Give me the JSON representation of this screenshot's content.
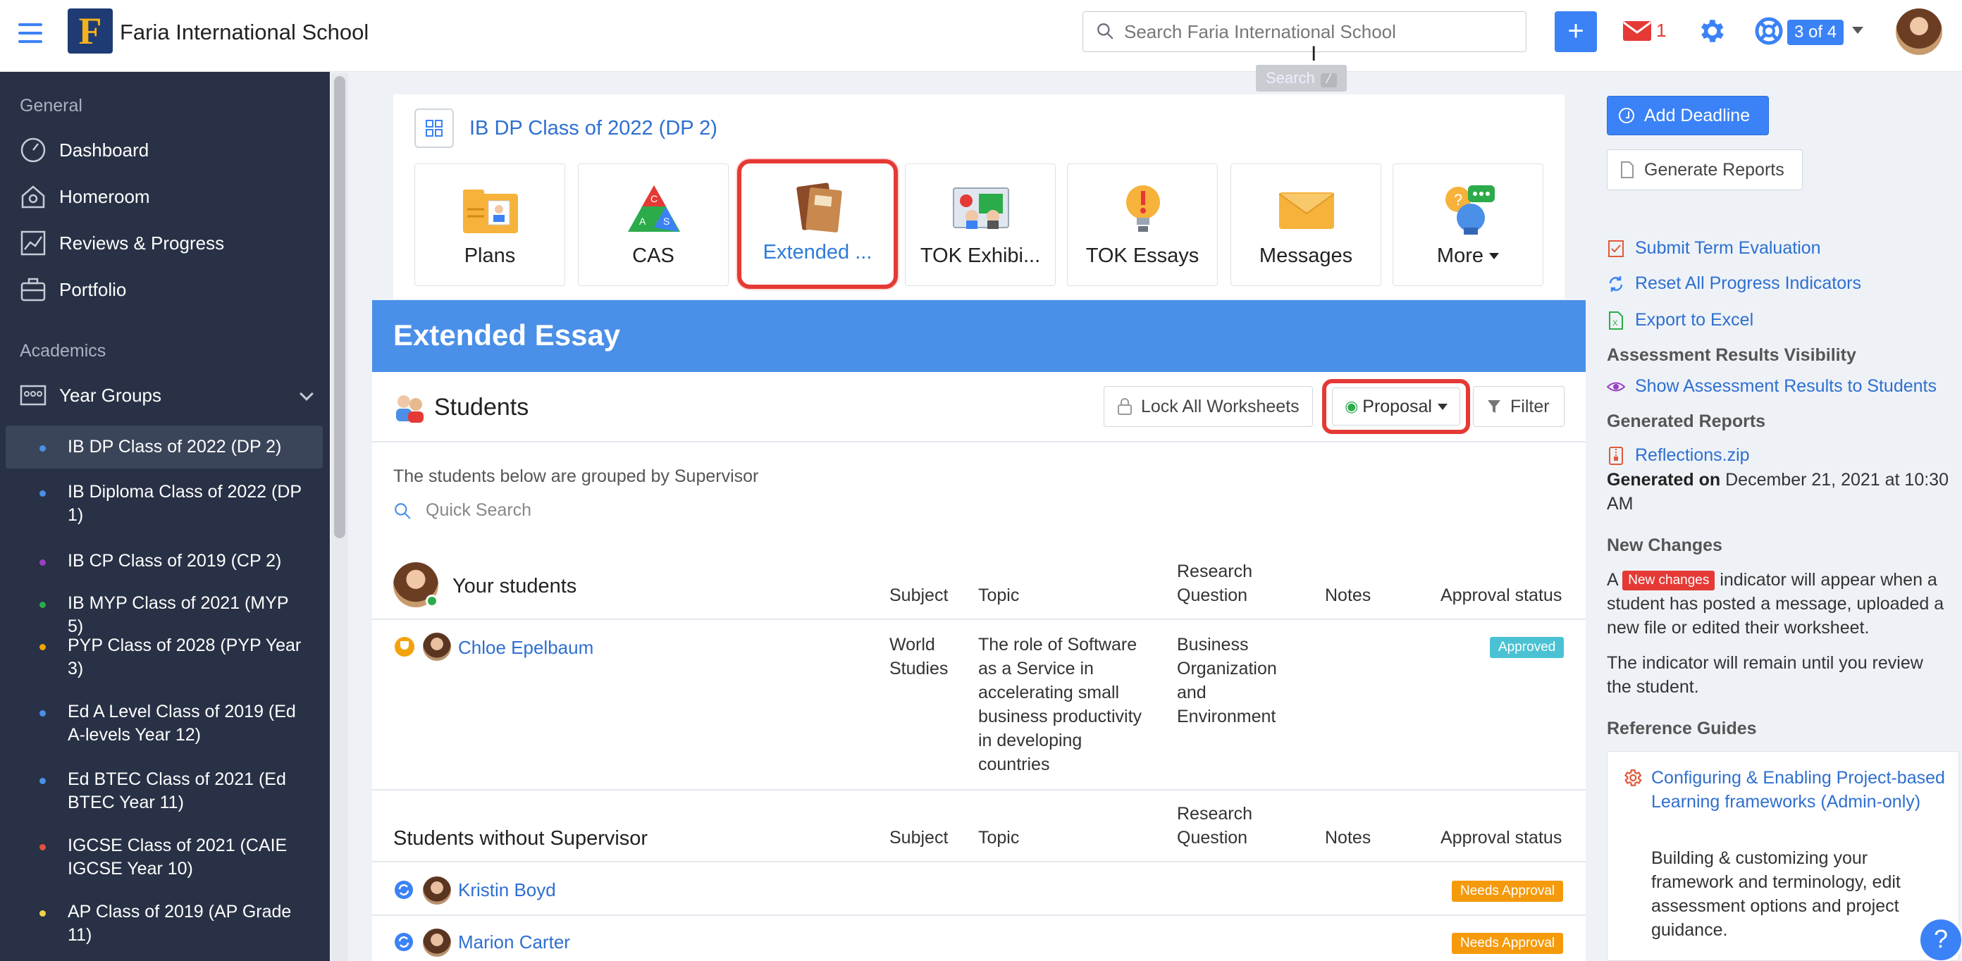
{
  "topbar": {
    "school_name": "Faria International School",
    "logo_letter": "F",
    "search_placeholder": "Search Faria International School",
    "search_tooltip": "Search",
    "search_shortcut": "/",
    "mail_count": "1",
    "pager": "3 of 4"
  },
  "sidebar": {
    "general_label": "General",
    "general_items": [
      {
        "label": "Dashboard",
        "icon": "dashboard-icon"
      },
      {
        "label": "Homeroom",
        "icon": "homeroom-icon"
      },
      {
        "label": "Reviews & Progress",
        "icon": "chart-line-icon"
      },
      {
        "label": "Portfolio",
        "icon": "briefcase-icon"
      }
    ],
    "academics_label": "Academics",
    "year_groups_label": "Year Groups",
    "classes": [
      {
        "label": "IB DP Class of 2022 (DP 2)",
        "color": "#4a8fe8",
        "active": true
      },
      {
        "label": "IB Diploma Class of 2022 (DP 1)",
        "color": "#4a8fe8"
      },
      {
        "label": "IB CP Class of 2019 (CP 2)",
        "color": "#9b3ec4"
      },
      {
        "label": "IB MYP Class of 2021 (MYP 5)",
        "color": "#2cab4a"
      },
      {
        "label": "PYP Class of 2028 (PYP Year 3)",
        "color": "#f2a20b"
      },
      {
        "label": "Ed A Level Class of 2019 (Ed A-levels Year 12)",
        "color": "#4a8fe8"
      },
      {
        "label": "Ed BTEC Class of 2021 (Ed BTEC Year 11)",
        "color": "#4a8fe8"
      },
      {
        "label": "IGCSE Class of 2021 (CAIE IGCSE Year 10)",
        "color": "#e0523e"
      },
      {
        "label": "AP Class of 2019 (AP Grade 11)",
        "color": "#f2d24b"
      }
    ]
  },
  "main": {
    "class_title": "IB DP Class of 2022 (DP 2)",
    "tiles": [
      {
        "label": "Plans",
        "icon": "plans-folder-icon"
      },
      {
        "label": "CAS",
        "icon": "cas-triangle-icon"
      },
      {
        "label": "Extended ...",
        "icon": "books-icon",
        "active": true
      },
      {
        "label": "TOK Exhibi...",
        "icon": "tok-exhibition-icon"
      },
      {
        "label": "TOK Essays",
        "icon": "lightbulb-icon"
      },
      {
        "label": "Messages",
        "icon": "envelope-icon"
      },
      {
        "label": "More",
        "icon": "more-bubbles-icon"
      }
    ],
    "banner_title": "Extended Essay",
    "students_title": "Students",
    "lock_label": "Lock All Worksheets",
    "proposal_label": "Proposal",
    "filter_label": "Filter",
    "grouped_note": "The students below are grouped by Supervisor",
    "quick_search_placeholder": "Quick Search",
    "columns": {
      "subject": "Subject",
      "topic": "Topic",
      "research_question": "Research Question",
      "notes": "Notes",
      "approval": "Approval status"
    },
    "your_students_title": "Your students",
    "your_students": [
      {
        "name": "Chloe Epelbaum",
        "subject": "World Studies",
        "topic": "The role of Software as a Service in accelerating small business productivity in developing countries",
        "research_question": "Business Organization and Environment",
        "status": "Approved"
      }
    ],
    "without_supervisor_title": "Students without Supervisor",
    "without_supervisor": [
      {
        "name": "Kristin Boyd",
        "status": "Needs Approval"
      },
      {
        "name": "Marion Carter",
        "status": "Needs Approval"
      }
    ]
  },
  "right": {
    "add_deadline": "Add Deadline",
    "generate_reports": "Generate Reports",
    "submit_term": "Submit Term Evaluation",
    "reset_progress": "Reset All Progress Indicators",
    "export_excel": "Export to Excel",
    "assessment_visibility_head": "Assessment Results Visibility",
    "show_results": "Show Assessment Results to Students",
    "generated_reports_head": "Generated Reports",
    "reflections_file": "Reflections.zip",
    "generated_on_label": "Generated on",
    "generated_on_value": "December 21, 2021 at 10:30 AM",
    "new_changes_head": "New Changes",
    "nc_prefix": "A",
    "nc_badge": "New changes",
    "nc_suffix": "indicator will appear when a student has posted a message, uploaded a new file or edited their worksheet.",
    "nc_remain": "The indicator will remain until you review the student.",
    "reference_head": "Reference Guides",
    "ref_link": "Configuring & Enabling Project-based Learning frameworks (Admin-only)",
    "ref_desc": "Building & customizing your framework and terminology, edit assessment options and project guidance."
  },
  "colors": {
    "accent": "#3b82f6",
    "banner": "#4a8fe8",
    "sidebar_bg": "#283145",
    "highlight": "#e53935",
    "approved": "#4ac2d3",
    "needs_approval": "#f59a0c"
  }
}
